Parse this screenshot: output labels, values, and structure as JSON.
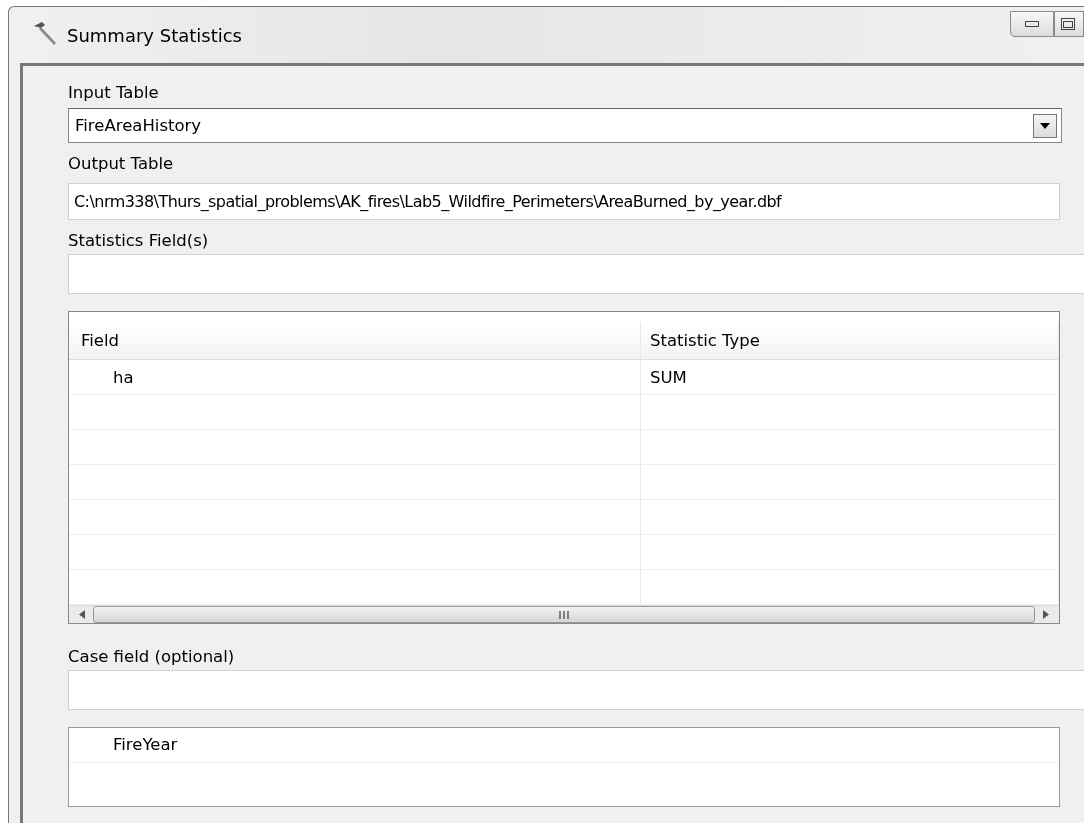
{
  "window": {
    "title": "Summary Statistics"
  },
  "input_table": {
    "label": "Input Table",
    "value": "FireAreaHistory"
  },
  "output_table": {
    "label": "Output Table",
    "value": "C:\\nrm338\\Thurs_spatial_problems\\AK_fires\\Lab5_Wildfire_Perimeters\\AreaBurned_by_year.dbf"
  },
  "statistics_fields": {
    "label": "Statistics Field(s)",
    "table": {
      "columns": [
        "Field",
        "Statistic Type"
      ],
      "rows": [
        [
          "ha",
          "SUM"
        ]
      ]
    }
  },
  "case_field": {
    "label": "Case field (optional)",
    "items": [
      "FireYear"
    ]
  }
}
